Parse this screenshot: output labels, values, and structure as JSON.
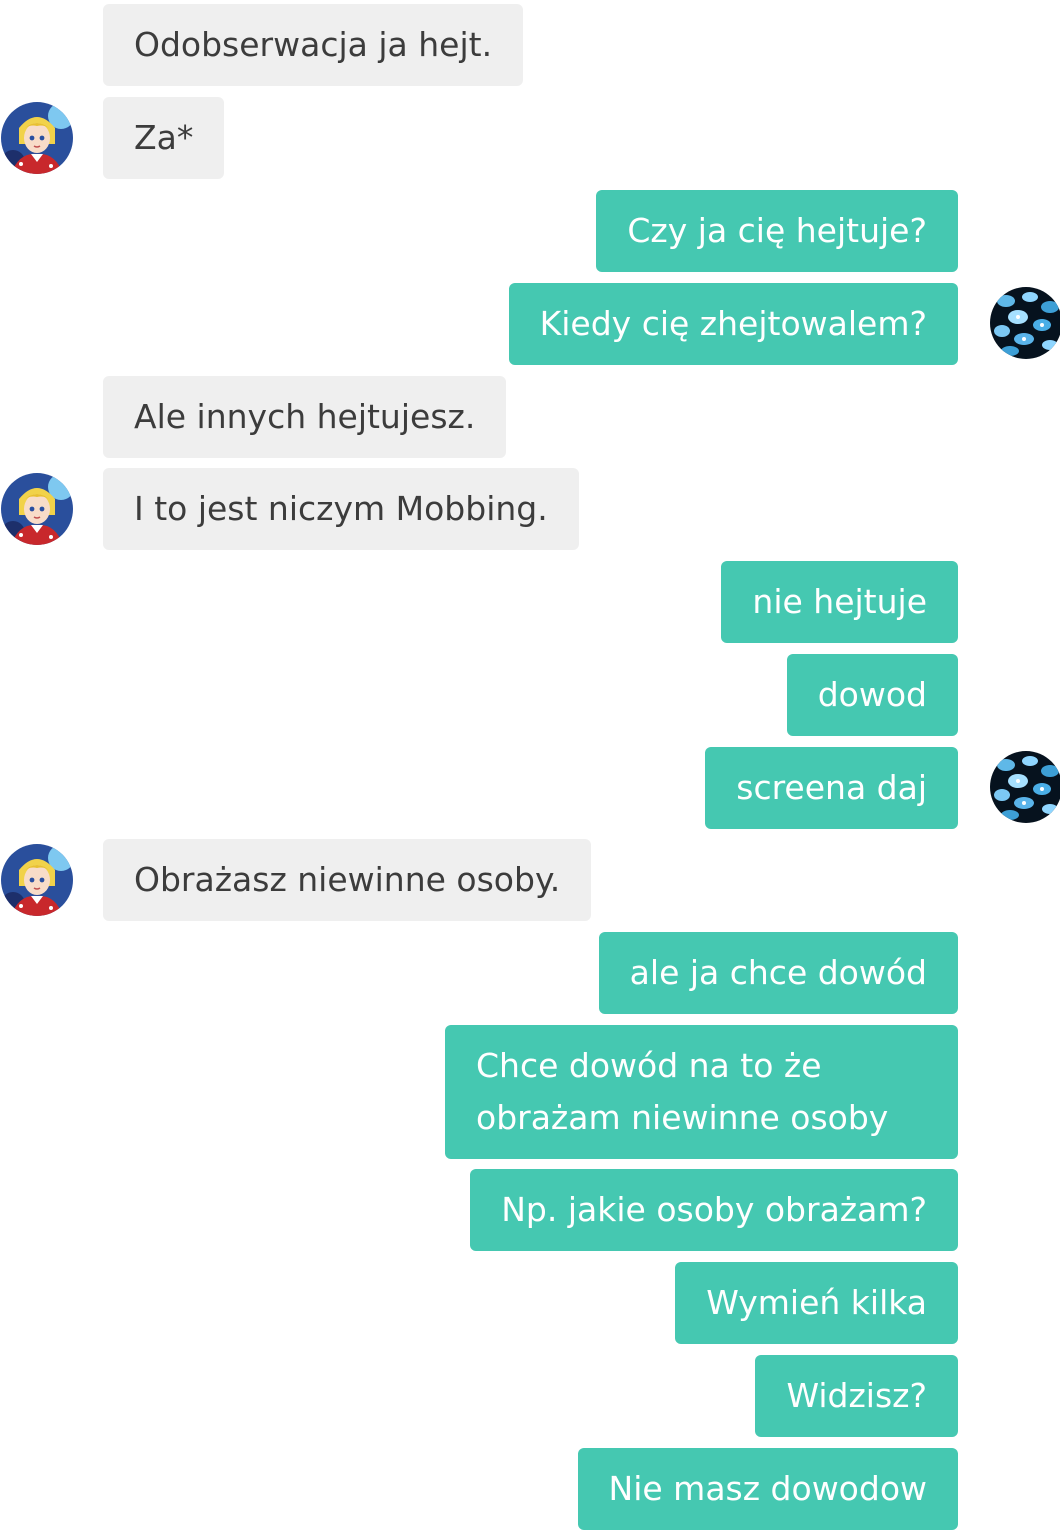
{
  "chat": {
    "messages": [
      {
        "side": "incoming",
        "text": "Odobserwacja ja hejt."
      },
      {
        "side": "incoming",
        "text": "Za*"
      },
      {
        "side": "outgoing",
        "text": "Czy ja cię hejtuje?"
      },
      {
        "side": "outgoing",
        "text": "Kiedy cię zhejtowalem?"
      },
      {
        "side": "incoming",
        "text": "Ale innych hejtujesz."
      },
      {
        "side": "incoming",
        "text": "I to jest niczym Mobbing."
      },
      {
        "side": "outgoing",
        "text": "nie hejtuje"
      },
      {
        "side": "outgoing",
        "text": "dowod"
      },
      {
        "side": "outgoing",
        "text": "screena daj"
      },
      {
        "side": "incoming",
        "text": "Obrażasz niewinne osoby."
      },
      {
        "side": "outgoing",
        "text": "ale ja chce dowód"
      },
      {
        "side": "outgoing",
        "text": "Chce dowód na to że obrażam niewinne osoby"
      },
      {
        "side": "outgoing",
        "text": "Np. jakie osoby obrażam?"
      },
      {
        "side": "outgoing",
        "text": "Wymień kilka"
      },
      {
        "side": "outgoing",
        "text": "Widzisz?"
      },
      {
        "side": "outgoing",
        "text": "Nie masz dowodow"
      }
    ],
    "avatars": {
      "left": {
        "icon": "anime-girl-avatar-icon"
      },
      "right": {
        "icon": "blue-butterflies-avatar-icon"
      }
    }
  },
  "colors": {
    "incoming_bubble": "#efefef",
    "incoming_text": "#3c3c3c",
    "outgoing_bubble": "#45c8b1",
    "outgoing_text": "#ffffff"
  }
}
